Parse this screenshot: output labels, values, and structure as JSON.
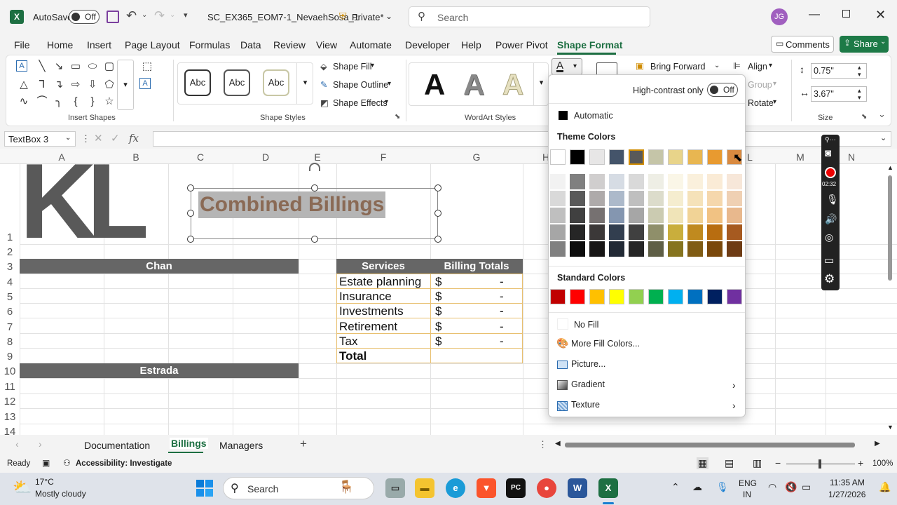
{
  "titlebar": {
    "autosave_label": "AutoSave",
    "autosave_state": "Off",
    "filename": "SC_EX365_EOM7-1_NevaehSosa_1",
    "sensitivity": "Private*",
    "search_placeholder": "Search",
    "user_initials": "JG"
  },
  "menu": [
    "File",
    "Home",
    "Insert",
    "Page Layout",
    "Formulas",
    "Data",
    "Review",
    "View",
    "Automate",
    "Developer",
    "Help",
    "Power Pivot",
    "Shape Format"
  ],
  "menu_active": "Shape Format",
  "actions": {
    "comments": "Comments",
    "share": "Share"
  },
  "ribbon": {
    "insert_shapes_label": "Insert Shapes",
    "shape_styles_label": "Shape Styles",
    "style_abc": [
      "Abc",
      "Abc",
      "Abc"
    ],
    "shape_fill": "Shape Fill",
    "shape_outline": "Shape Outline",
    "shape_effects": "Shape Effects",
    "wordart_label": "WordArt Styles",
    "wordart_letters": [
      "A",
      "A",
      "A"
    ],
    "bring_forward": "Bring Forward",
    "align": "Align",
    "group": "Group",
    "rotate": "Rotate",
    "height": "0.75\"",
    "width": "3.67\"",
    "size_label": "Size"
  },
  "formula": {
    "namebox": "TextBox 3",
    "fx": "fx"
  },
  "columns": [
    "A",
    "B",
    "C",
    "D",
    "E",
    "F",
    "G",
    "H",
    "L",
    "M",
    "N"
  ],
  "rows": [
    "1",
    "2",
    "3",
    "4",
    "5",
    "6",
    "7",
    "8",
    "9",
    "10",
    "11",
    "12",
    "13",
    "14"
  ],
  "sheet": {
    "logo": "KL",
    "title": "Combined Billings",
    "chan": "Chan",
    "estrada": "Estrada",
    "services_header": "Services",
    "totals_header": "Billing Totals",
    "services": [
      "Estate planning",
      "Insurance",
      "Investments",
      "Retirement",
      "Tax"
    ],
    "dollar": "$",
    "dash": "-",
    "total": "Total"
  },
  "tabs": [
    "Documentation",
    "Billings",
    "Managers"
  ],
  "active_tab": "Billings",
  "status": {
    "ready": "Ready",
    "accessibility": "Accessibility: Investigate",
    "zoom": "100%"
  },
  "color_panel": {
    "high_contrast": "High-contrast only",
    "hc_state": "Off",
    "automatic": "Automatic",
    "theme_colors": "Theme Colors",
    "standard_colors": "Standard Colors",
    "no_fill": "No Fill",
    "more_colors": "More Fill Colors...",
    "picture": "Picture...",
    "gradient": "Gradient",
    "texture": "Texture",
    "theme_row": [
      "#ffffff",
      "#000000",
      "#e7e6e6",
      "#44546a",
      "#595959",
      "#c5c5a8",
      "#e8d48a",
      "#e8b651",
      "#e89a30",
      "#d98a40"
    ],
    "theme_shades": [
      [
        "#f2f2f2",
        "#d9d9d9",
        "#bfbfbf",
        "#a6a6a6",
        "#808080"
      ],
      [
        "#808080",
        "#595959",
        "#404040",
        "#262626",
        "#0d0d0d"
      ],
      [
        "#d0cece",
        "#aeaaaa",
        "#767171",
        "#3b3838",
        "#171616"
      ],
      [
        "#d6dce4",
        "#acb9ca",
        "#8496b0",
        "#323e4f",
        "#222a35"
      ],
      [
        "#d9d9d9",
        "#bfbfbf",
        "#a6a6a6",
        "#404040",
        "#262626"
      ],
      [
        "#eeeee5",
        "#dcdccb",
        "#cbcbb1",
        "#8f8f6a",
        "#5f5f46"
      ],
      [
        "#faf6e7",
        "#f5edcf",
        "#f0e4b8",
        "#c9ae3c",
        "#86741f"
      ],
      [
        "#faf0dc",
        "#f5e2b9",
        "#f1d396",
        "#c08a1f",
        "#805c14"
      ],
      [
        "#faebd6",
        "#f5d7ac",
        "#f1c283",
        "#b86d10",
        "#7a480b"
      ],
      [
        "#f7e7d9",
        "#efd0b3",
        "#e8b88d",
        "#a65a20",
        "#6e3c15"
      ]
    ],
    "standard_row": [
      "#c00000",
      "#ff0000",
      "#ffc000",
      "#ffff00",
      "#92d050",
      "#00b050",
      "#00b0f0",
      "#0070c0",
      "#002060",
      "#7030a0"
    ]
  },
  "recorder": {
    "time": "02:32"
  },
  "taskbar": {
    "temp": "17°C",
    "weather": "Mostly cloudy",
    "search": "Search",
    "lang1": "ENG",
    "lang2": "IN",
    "time": "11:35 AM",
    "date": "1/27/2026"
  }
}
